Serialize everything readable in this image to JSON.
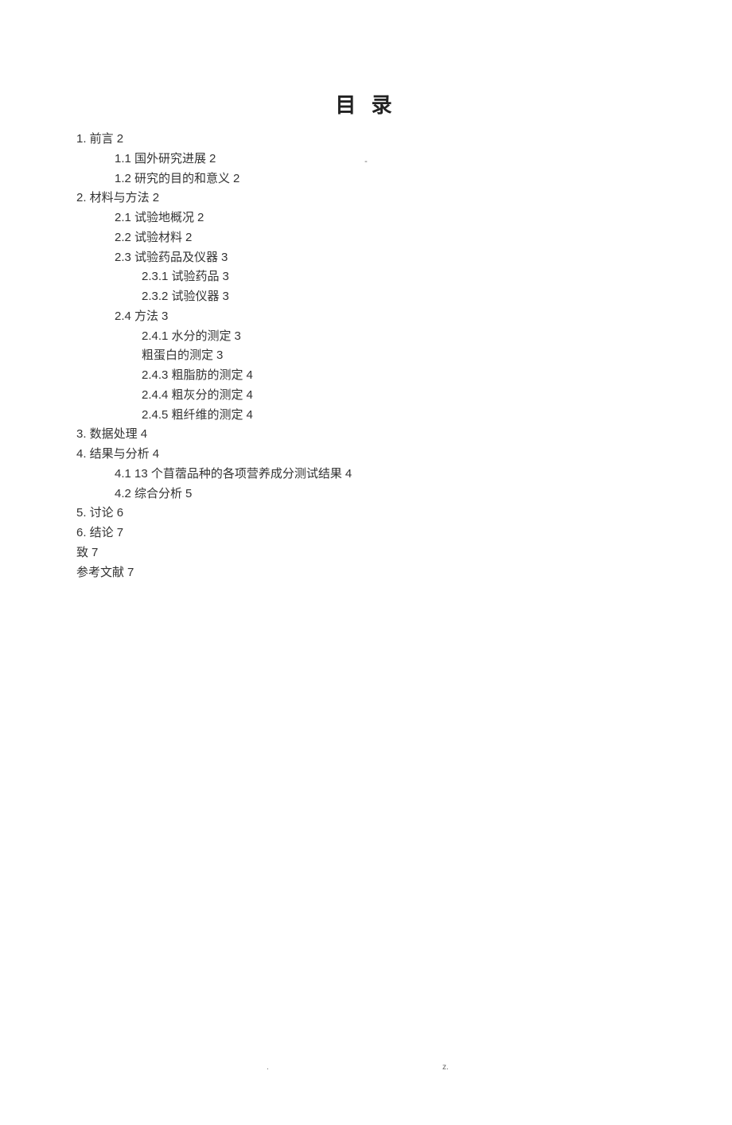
{
  "top_mark": "-",
  "title": "目 录",
  "entries": [
    {
      "level": 1,
      "label": "1.  前言",
      "page": "2"
    },
    {
      "level": 2,
      "label": "1.1  国外研究进展",
      "page": "2"
    },
    {
      "level": 2,
      "label": "1.2  研究的目的和意义",
      "page": "2"
    },
    {
      "level": 1,
      "label": "2.  材料与方法",
      "page": "2"
    },
    {
      "level": 2,
      "label": "2.1  试验地概况",
      "page": "2"
    },
    {
      "level": 2,
      "label": "2.2  试验材料",
      "page": "2"
    },
    {
      "level": 2,
      "label": "2.3  试验药品及仪器",
      "page": "3"
    },
    {
      "level": 3,
      "label": "2.3.1  试验药品",
      "page": "3"
    },
    {
      "level": 3,
      "label": "2.3.2  试验仪器",
      "page": "3"
    },
    {
      "level": 2,
      "label": "2.4  方法",
      "page": "3"
    },
    {
      "level": 3,
      "label": "2.4.1  水分的测定",
      "page": "3"
    },
    {
      "level": 3,
      "label": "  粗蛋白的测定",
      "page": "3"
    },
    {
      "level": 3,
      "label": "2.4.3  粗脂肪的测定",
      "page": "4"
    },
    {
      "level": 3,
      "label": "2.4.4  粗灰分的测定",
      "page": "4"
    },
    {
      "level": 3,
      "label": "2.4.5  粗纤维的测定",
      "page": "4"
    },
    {
      "level": 1,
      "label": "3.  数据处理",
      "page": "4"
    },
    {
      "level": 1,
      "label": "4.  结果与分析",
      "page": "4"
    },
    {
      "level": 2,
      "label": "4.1 13 个苜蓿品种的各项营养成分测试结果",
      "page": "4"
    },
    {
      "level": 2,
      "label": "4.2  综合分析",
      "page": "5"
    },
    {
      "level": 1,
      "label": "5.  讨论",
      "page": "6"
    },
    {
      "level": 1,
      "label": "6.  结论",
      "page": "7"
    },
    {
      "level": 1,
      "label": "致",
      "page": "7"
    },
    {
      "level": 1,
      "label": "参考文献",
      "page": "7"
    }
  ],
  "footer_dot": ".",
  "footer_z": "z."
}
